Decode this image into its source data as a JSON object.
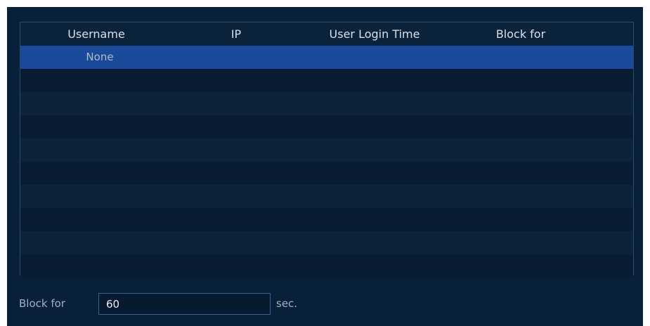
{
  "table": {
    "headers": {
      "username": "Username",
      "ip": "IP",
      "login_time": "User Login Time",
      "block_for": "Block for"
    },
    "rows": [
      {
        "username": "None",
        "ip": "",
        "login_time": "",
        "block_for": ""
      },
      {
        "username": "",
        "ip": "",
        "login_time": "",
        "block_for": ""
      },
      {
        "username": "",
        "ip": "",
        "login_time": "",
        "block_for": ""
      },
      {
        "username": "",
        "ip": "",
        "login_time": "",
        "block_for": ""
      },
      {
        "username": "",
        "ip": "",
        "login_time": "",
        "block_for": ""
      },
      {
        "username": "",
        "ip": "",
        "login_time": "",
        "block_for": ""
      },
      {
        "username": "",
        "ip": "",
        "login_time": "",
        "block_for": ""
      },
      {
        "username": "",
        "ip": "",
        "login_time": "",
        "block_for": ""
      },
      {
        "username": "",
        "ip": "",
        "login_time": "",
        "block_for": ""
      },
      {
        "username": "",
        "ip": "",
        "login_time": "",
        "block_for": ""
      }
    ],
    "selected_row": 0
  },
  "footer": {
    "block_for_label": "Block for",
    "block_for_value": "60",
    "unit_label": "sec."
  },
  "colors": {
    "panel_background": "#08203a",
    "selected_row": "#1a4a99",
    "border": "#2e4a68"
  }
}
